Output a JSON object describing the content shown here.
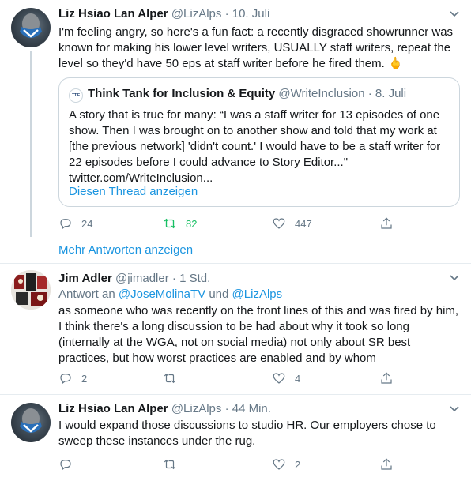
{
  "tweets": [
    {
      "name": "Liz Hsiao Lan Alper",
      "handle": "@LizAlps",
      "time": "10. Juli",
      "text": "I'm feeling angry, so here's a fun fact: a recently disgraced showrunner was known for making his lower level writers, USUALLY staff writers, repeat the level so they'd have 50 eps at staff writer before he fired them. 🖕",
      "quote": {
        "avatar_text": "TTIE",
        "name": "Think Tank for Inclusion & Equity",
        "handle": "@WriteInclusion",
        "time": "8. Juli",
        "text": "A story that is true for many: “I was a staff writer for 13 episodes of one show. Then I was brought on to another show and told that my work at [the previous network] 'didn't count.' I would have to be a staff writer for 22 episodes before I could advance to Story Editor...\" twitter.com/WriteInclusion...",
        "show_thread": "Diesen Thread anzeigen"
      },
      "actions": {
        "replies": "24",
        "retweets": "82",
        "likes": "447"
      }
    },
    {
      "name": "Jim Adler",
      "handle": "@jimadler",
      "time": "1 Std.",
      "reply_prefix": "Antwort an",
      "reply_user1": "@JoseMolinaTV",
      "reply_and": "und",
      "reply_user2": "@LizAlps",
      "text": "as someone who was recently on the front lines of this and was fired by him, I think there's a long discussion to be had about why it took so long (internally at the WGA, not on social media) not only about SR best practices, but how worst practices are enabled and by whom",
      "actions": {
        "replies": "2",
        "retweets": "",
        "likes": "4"
      }
    },
    {
      "name": "Liz Hsiao Lan Alper",
      "handle": "@LizAlps",
      "time": "44 Min.",
      "text": "I would expand those discussions to studio HR. Our employers chose to sweep these instances under the rug.",
      "actions": {
        "replies": "",
        "retweets": "",
        "likes": "2"
      }
    }
  ],
  "more_replies": "Mehr Antworten anzeigen",
  "separator_dot": "·",
  "colors": {
    "link": "#1b95e0",
    "retweet_active": "#17bf63",
    "muted": "#657786",
    "border": "#ccd6dd"
  },
  "icons": [
    "reply-icon",
    "retweet-icon",
    "like-icon",
    "share-icon",
    "caret-down-icon"
  ]
}
